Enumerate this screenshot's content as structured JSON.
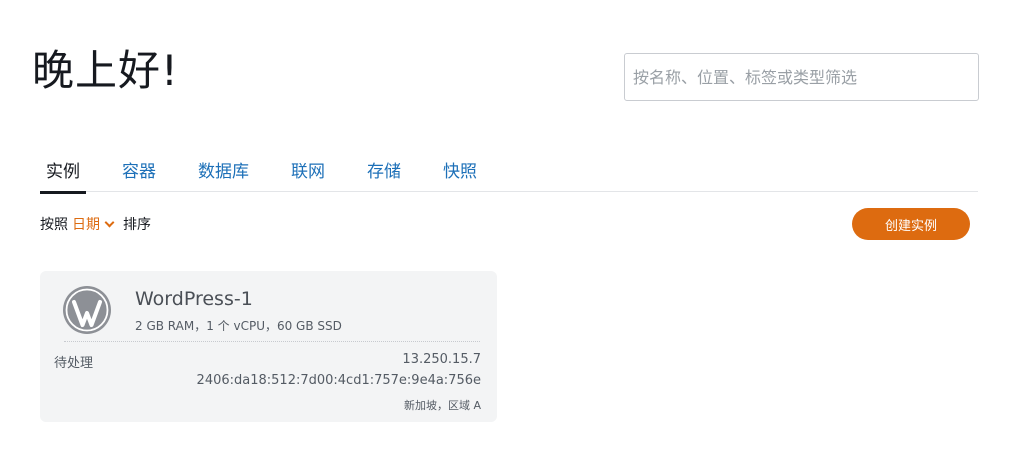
{
  "greeting": "晚上好!",
  "search": {
    "placeholder": "按名称、位置、标签或类型筛选",
    "value": ""
  },
  "tabs": [
    {
      "label": "实例",
      "active": true
    },
    {
      "label": "容器"
    },
    {
      "label": "数据库"
    },
    {
      "label": "联网"
    },
    {
      "label": "存储"
    },
    {
      "label": "快照"
    }
  ],
  "sort": {
    "prefix": "按照",
    "key": "日期",
    "suffix": "排序",
    "key_icon": "chevron-down-icon"
  },
  "create_button": "创建实例",
  "instances": [
    {
      "icon": "wordpress-icon",
      "name": "WordPress-1",
      "spec": "2 GB RAM，1 个 vCPU，60 GB SSD",
      "status": "待处理",
      "ipv4": "13.250.15.7",
      "ipv6": "2406:da18:512:7d00:4cd1:757e:9e4a:756e",
      "region": "新加坡，区域 A"
    }
  ],
  "colors": {
    "accent": "#dd6b10",
    "link": "#1d70b8",
    "card_bg": "#f3f4f5"
  }
}
